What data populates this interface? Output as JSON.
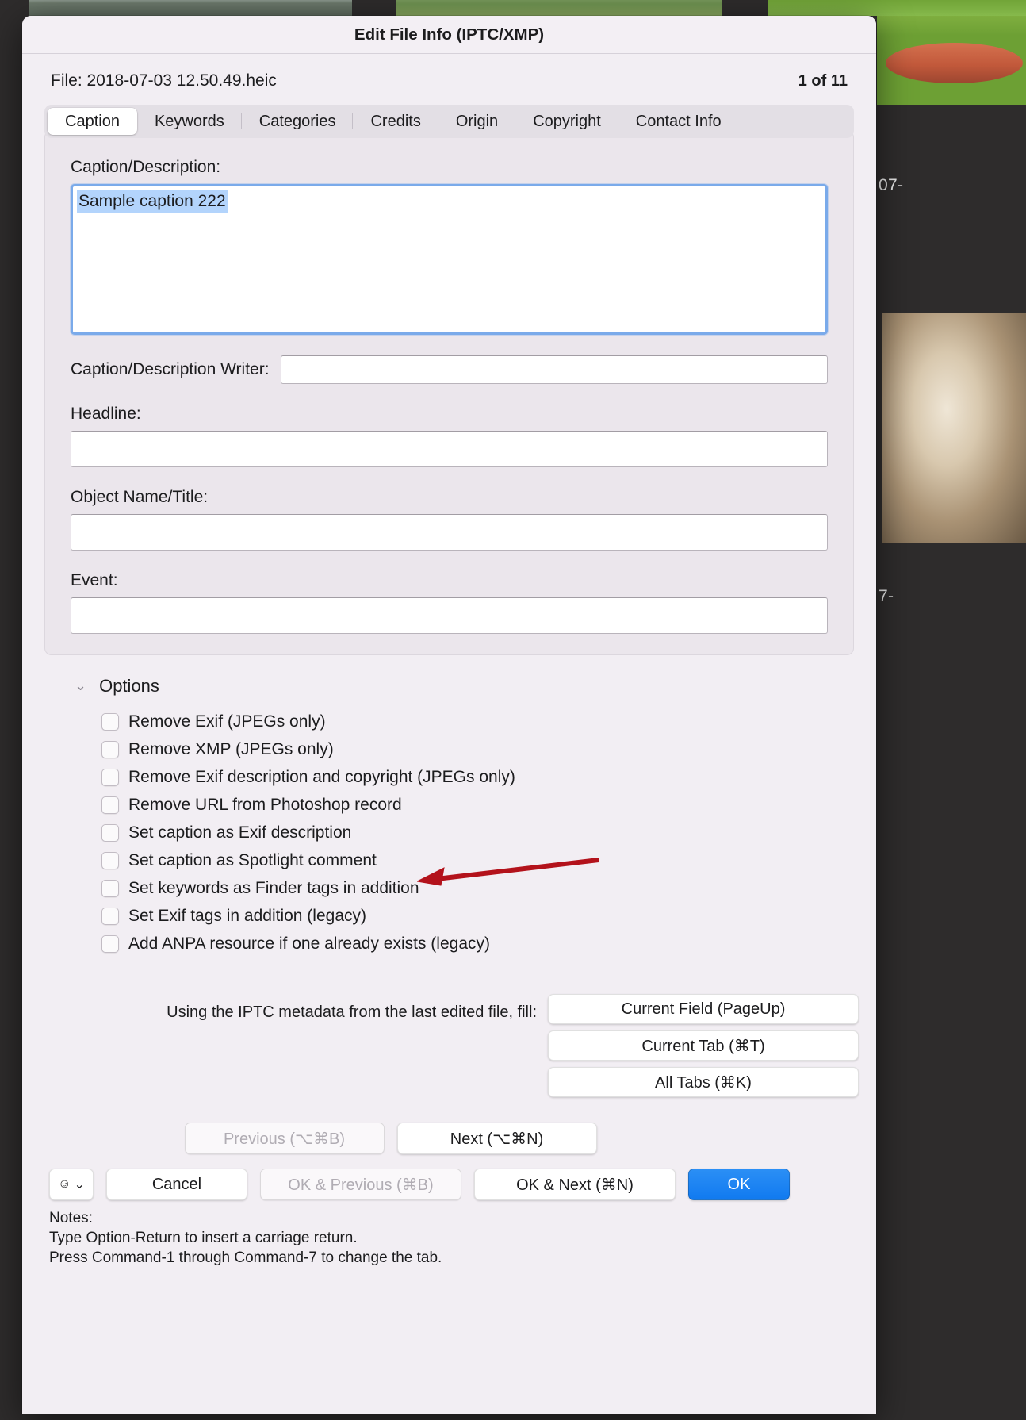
{
  "window": {
    "title": "Edit File Info (IPTC/XMP)",
    "file_label": "File: 2018-07-03 12.50.49.heic",
    "counter": "1 of 11"
  },
  "tabs": [
    {
      "label": "Caption",
      "selected": true
    },
    {
      "label": "Keywords",
      "selected": false
    },
    {
      "label": "Categories",
      "selected": false
    },
    {
      "label": "Credits",
      "selected": false
    },
    {
      "label": "Origin",
      "selected": false
    },
    {
      "label": "Copyright",
      "selected": false
    },
    {
      "label": "Contact Info",
      "selected": false
    }
  ],
  "caption_panel": {
    "caption_label": "Caption/Description:",
    "caption_value": "Sample caption 222",
    "writer_label": "Caption/Description Writer:",
    "writer_value": "",
    "headline_label": "Headline:",
    "headline_value": "",
    "object_name_label": "Object Name/Title:",
    "object_name_value": "",
    "event_label": "Event:",
    "event_value": ""
  },
  "options": {
    "title": "Options",
    "chevron": "⌄",
    "items": [
      {
        "label": "Remove Exif (JPEGs only)",
        "checked": false
      },
      {
        "label": "Remove XMP (JPEGs only)",
        "checked": false
      },
      {
        "label": "Remove Exif description and copyright (JPEGs only)",
        "checked": false
      },
      {
        "label": "Remove URL from Photoshop record",
        "checked": false
      },
      {
        "label": "Set caption as Exif description",
        "checked": false
      },
      {
        "label": "Set caption as Spotlight comment",
        "checked": false
      },
      {
        "label": "Set keywords as Finder tags in addition",
        "checked": false
      },
      {
        "label": "Set Exif tags in addition (legacy)",
        "checked": false
      },
      {
        "label": "Add ANPA resource if one already exists (legacy)",
        "checked": false
      }
    ]
  },
  "annotation": {
    "color": "#b3121b",
    "points_at": "Set caption as Spotlight comment"
  },
  "fill": {
    "label": "Using the IPTC metadata from the last edited file, fill:",
    "buttons": [
      "Current Field (PageUp)",
      "Current Tab (⌘T)",
      "All Tabs (⌘K)"
    ]
  },
  "nav": {
    "previous": "Previous (⌥⌘B)",
    "previous_disabled": true,
    "next": "Next (⌥⌘N)",
    "next_disabled": false
  },
  "actions": {
    "emoji_button": "☺",
    "emoji_chevron": "⌄",
    "cancel": "Cancel",
    "ok_previous": "OK & Previous (⌘B)",
    "ok_previous_disabled": true,
    "ok_next": "OK & Next (⌘N)",
    "ok": "OK",
    "ok_color": "#117af0"
  },
  "notes": {
    "heading": "Notes:",
    "line1": "Type Option-Return to insert a carriage return.",
    "line2": "Press Command-1 through Command-7 to change the tab."
  },
  "backdrop": {
    "labels": [
      "07-",
      "7-"
    ]
  }
}
